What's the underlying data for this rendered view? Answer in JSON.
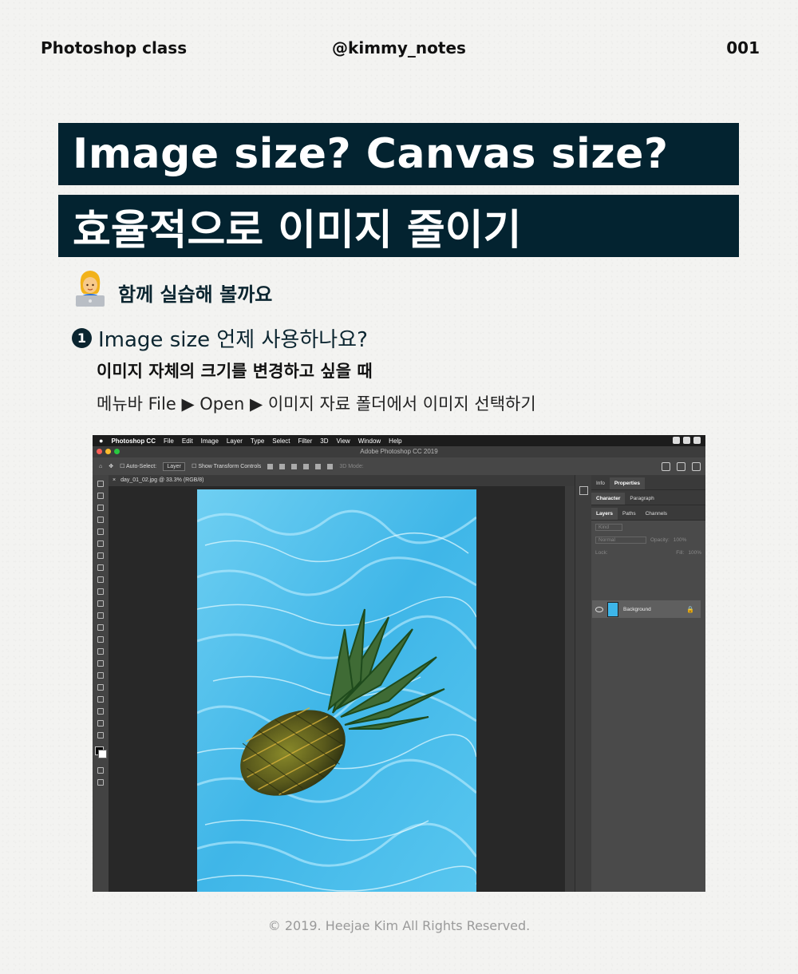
{
  "header": {
    "left": "Photoshop class",
    "center": "@kimmy_notes",
    "right": "001"
  },
  "title": {
    "line1": "Image size? Canvas size?",
    "line2": "효율적으로 이미지 줄이기"
  },
  "intro": {
    "text": "함께 실습해 볼까요"
  },
  "section": {
    "number": "1",
    "title": "Image size 언제 사용하나요?",
    "subtitle": "이미지 자체의 크기를 변경하고 싶을 때",
    "description": "메뉴바 File ▶ Open ▶ 이미지 자료 폴더에서 이미지 선택하기"
  },
  "photoshop": {
    "menubar": {
      "app": "Photoshop CC",
      "items": [
        "File",
        "Edit",
        "Image",
        "Layer",
        "Type",
        "Select",
        "Filter",
        "3D",
        "View",
        "Window",
        "Help"
      ]
    },
    "window_title": "Adobe Photoshop CC 2019",
    "options": {
      "auto_select": "Auto-Select:",
      "layer": "Layer",
      "show_transform": "Show Transform Controls",
      "mode_3d": "3D Mode:"
    },
    "doc_tab": "day_01_02.jpg @ 33.3% (RGB/8)",
    "panel": {
      "tabs1": [
        "Info",
        "Properties"
      ],
      "tabs2": [
        "Character",
        "Paragraph"
      ],
      "tabs3": [
        "Layers",
        "Paths",
        "Channels"
      ],
      "kind": "Kind",
      "blend": "Normal",
      "opacity": "Opacity:",
      "opacity_val": "100%",
      "lock": "Lock:",
      "fill": "Fill:",
      "fill_val": "100%",
      "layer_name": "Background"
    }
  },
  "footer": "© 2019. Heejae Kim All Rights Reserved."
}
